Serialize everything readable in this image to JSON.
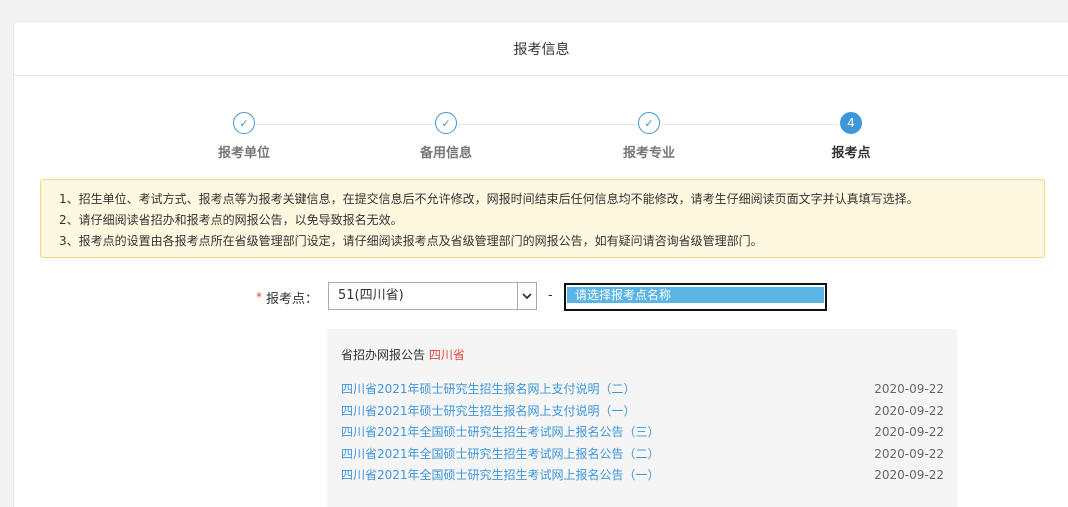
{
  "header": {
    "title": "报考信息"
  },
  "steps": [
    {
      "label": "报考单位",
      "state": "done",
      "icon": "check-icon"
    },
    {
      "label": "备用信息",
      "state": "done",
      "icon": "check-icon"
    },
    {
      "label": "报考专业",
      "state": "done",
      "icon": "check-icon"
    },
    {
      "label": "报考点",
      "state": "active",
      "number": "4"
    }
  ],
  "notice": {
    "lines": [
      "1、招生单位、考试方式、报考点等为报考关键信息，在提交信息后不允许修改，网报时间结束后任何信息均不能修改，请考生仔细阅读页面文字并认真填写选择。",
      "2、请仔细阅读省招办和报考点的网报公告，以免导致报名无效。",
      "3、报考点的设置由各报考点所在省级管理部门设定，请仔细阅读报考点及省级管理部门的网报公告，如有疑问请咨询省级管理部门。"
    ]
  },
  "form": {
    "required_mark": "*",
    "label": "报考点：",
    "province_value": "51(四川省)",
    "separator": "-",
    "site_placeholder": "请选择报考点名称"
  },
  "announcements": {
    "title": "省招办网报公告",
    "province": "四川省",
    "items": [
      {
        "title": "四川省2021年硕士研究生招生报名网上支付说明（二）",
        "date": "2020-09-22"
      },
      {
        "title": "四川省2021年硕士研究生招生报名网上支付说明（一）",
        "date": "2020-09-22"
      },
      {
        "title": "四川省2021年全国硕士研究生招生考试网上报名公告（三）",
        "date": "2020-09-22"
      },
      {
        "title": "四川省2021年全国硕士研究生招生考试网上报名公告（二）",
        "date": "2020-09-22"
      },
      {
        "title": "四川省2021年全国硕士研究生招生考试网上报名公告（一）",
        "date": "2020-09-22"
      }
    ]
  },
  "colors": {
    "accent": "#3e97d9",
    "required": "#e0453b",
    "notice_bg": "#fff8e1",
    "highlight": "#5ab5e4"
  }
}
